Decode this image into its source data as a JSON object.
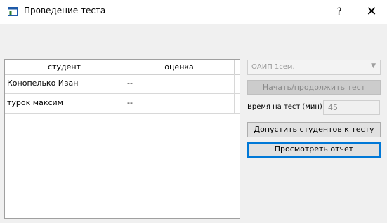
{
  "window": {
    "title": "Проведение теста",
    "help_label": "?",
    "close_label": "✕"
  },
  "table": {
    "headers": [
      "студент",
      "оценка"
    ],
    "rows": [
      {
        "student": "Конопелько Иван",
        "grade": "--"
      },
      {
        "student": "турок максим",
        "grade": "--"
      }
    ]
  },
  "controls": {
    "subject_combo": "ОАИП 1сем.",
    "start_button": "Начать/продолжить тест",
    "time_label": "Время на тест (мин)",
    "time_value": "45",
    "admit_button": "Допустить студентов к тесту",
    "report_button": "Просмотреть отчет"
  }
}
